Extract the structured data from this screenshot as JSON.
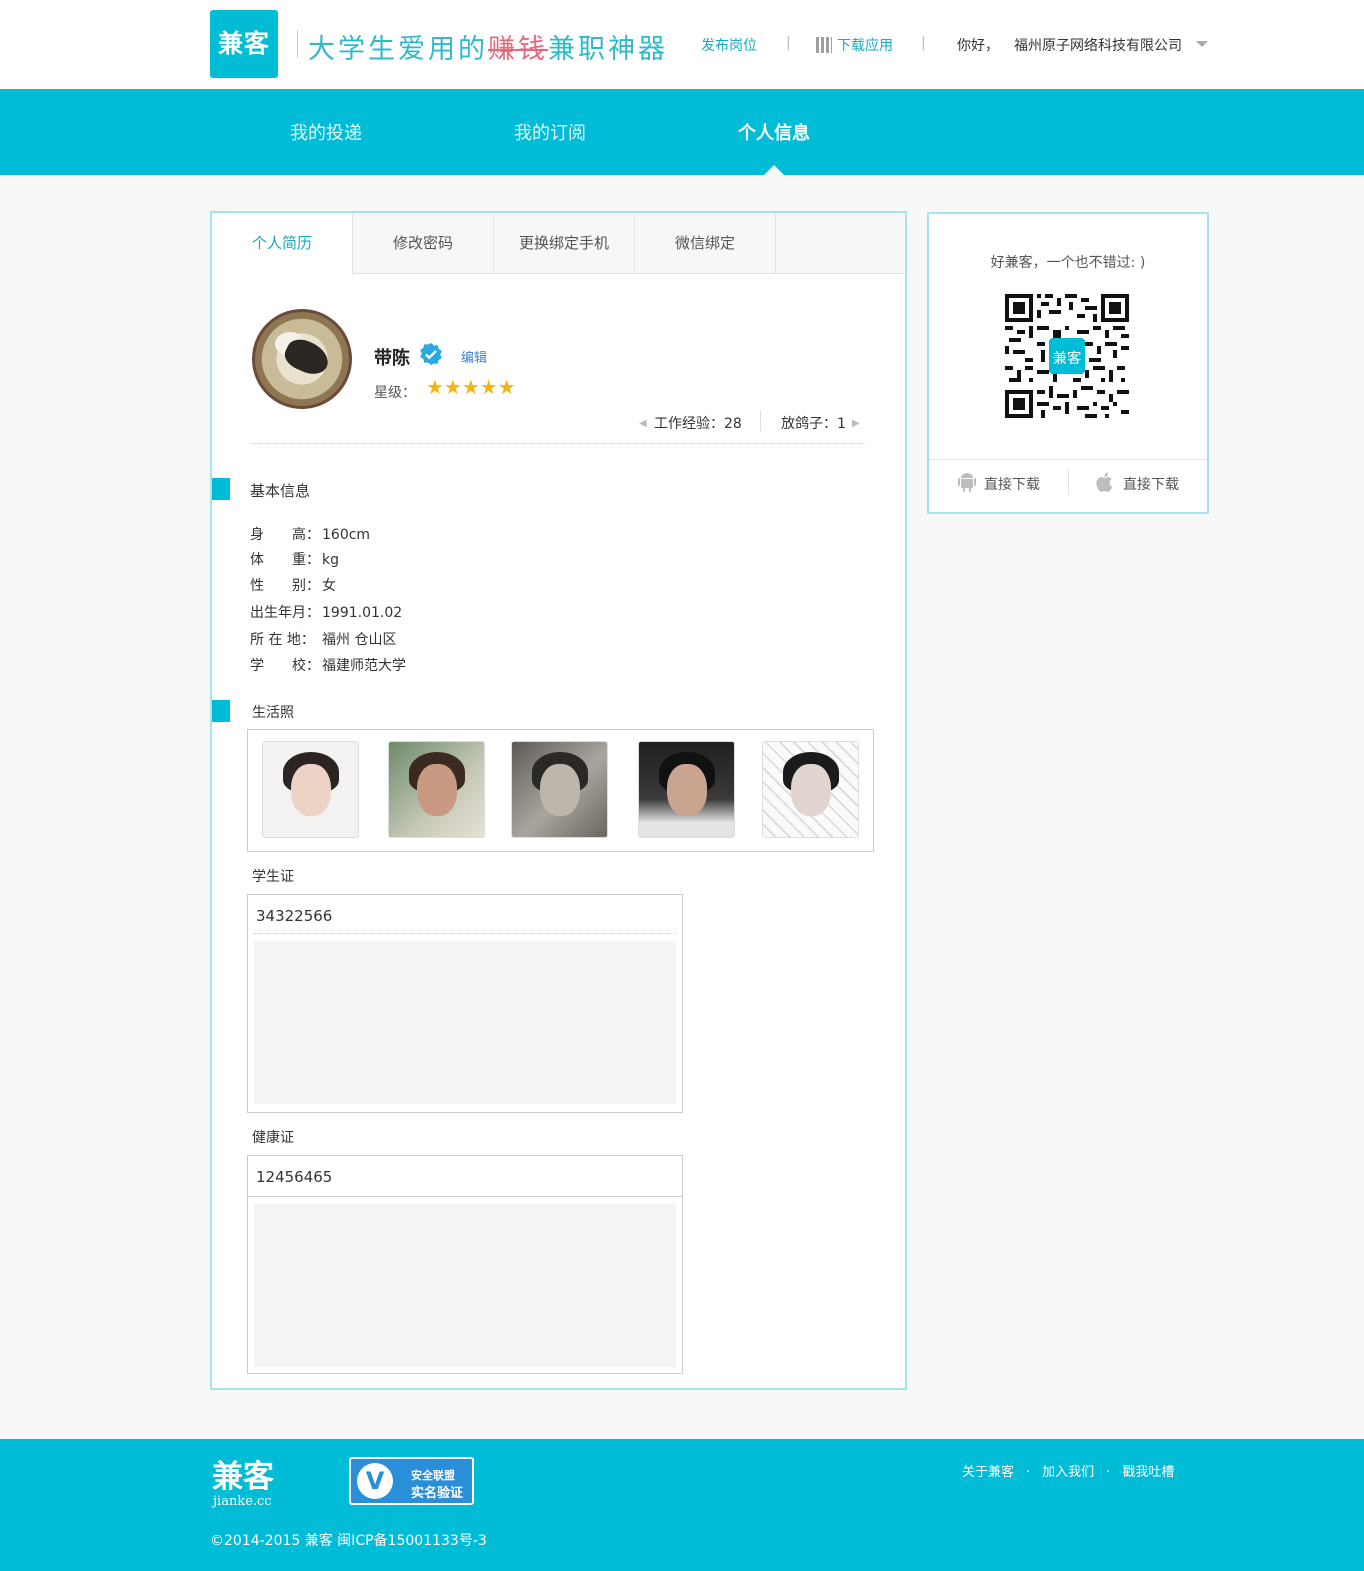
{
  "header": {
    "logo": "兼客",
    "slogan_a": "大学生爱用的",
    "slogan_strike": "赚钱",
    "slogan_b": "兼职神器",
    "post_job": "发布岗位",
    "download_app": "下载应用",
    "greeting": "你好，",
    "company": "福州原子网络科技有限公司"
  },
  "nav": {
    "items": [
      "我的投递",
      "我的订阅",
      "个人信息"
    ],
    "active": "个人信息"
  },
  "tabs": [
    "个人简历",
    "修改密码",
    "更换绑定手机",
    "微信绑定"
  ],
  "profile": {
    "name": "带陈",
    "edit": "编辑",
    "stars_label": "星级：",
    "stars": 5,
    "stars_text": "★★★★★",
    "work_exp": "工作经验：28",
    "no_show": "放鸽子：1"
  },
  "basic": {
    "title": "基本信息",
    "rows": [
      {
        "k": "身　　高：",
        "v": "160cm"
      },
      {
        "k": "体　　重：",
        "v": "kg"
      },
      {
        "k": "性　　别：",
        "v": "女"
      },
      {
        "k": "出生年月：",
        "v": "1991.01.02"
      },
      {
        "k": "所 在 地：",
        "v": "福州 仓山区"
      },
      {
        "k": "学　　校：",
        "v": "福建师范大学"
      }
    ]
  },
  "life_photos": {
    "title": "生活照",
    "count": 5
  },
  "student_card": {
    "label": "学生证",
    "number": "34322566"
  },
  "health_card": {
    "label": "健康证",
    "number": "12456465"
  },
  "side": {
    "tagline": "好兼客，一个也不错过: )",
    "qr_label": "兼客",
    "android_download": "直接下载",
    "ios_download": "直接下载"
  },
  "footer": {
    "logo": "兼客",
    "logo_sub": "jianke.cc",
    "badge_line1": "安全联盟",
    "badge_line2": "实名验证",
    "links": [
      "关于兼客",
      "加入我们",
      "戳我吐槽"
    ],
    "copyright": "©2014-2015 兼客 闽ICP备15001133号-3"
  },
  "colors": {
    "accent": "#00bcd6",
    "link": "#1aa8c2",
    "star": "#f5b50c",
    "panel_border": "#a8e3ed"
  }
}
